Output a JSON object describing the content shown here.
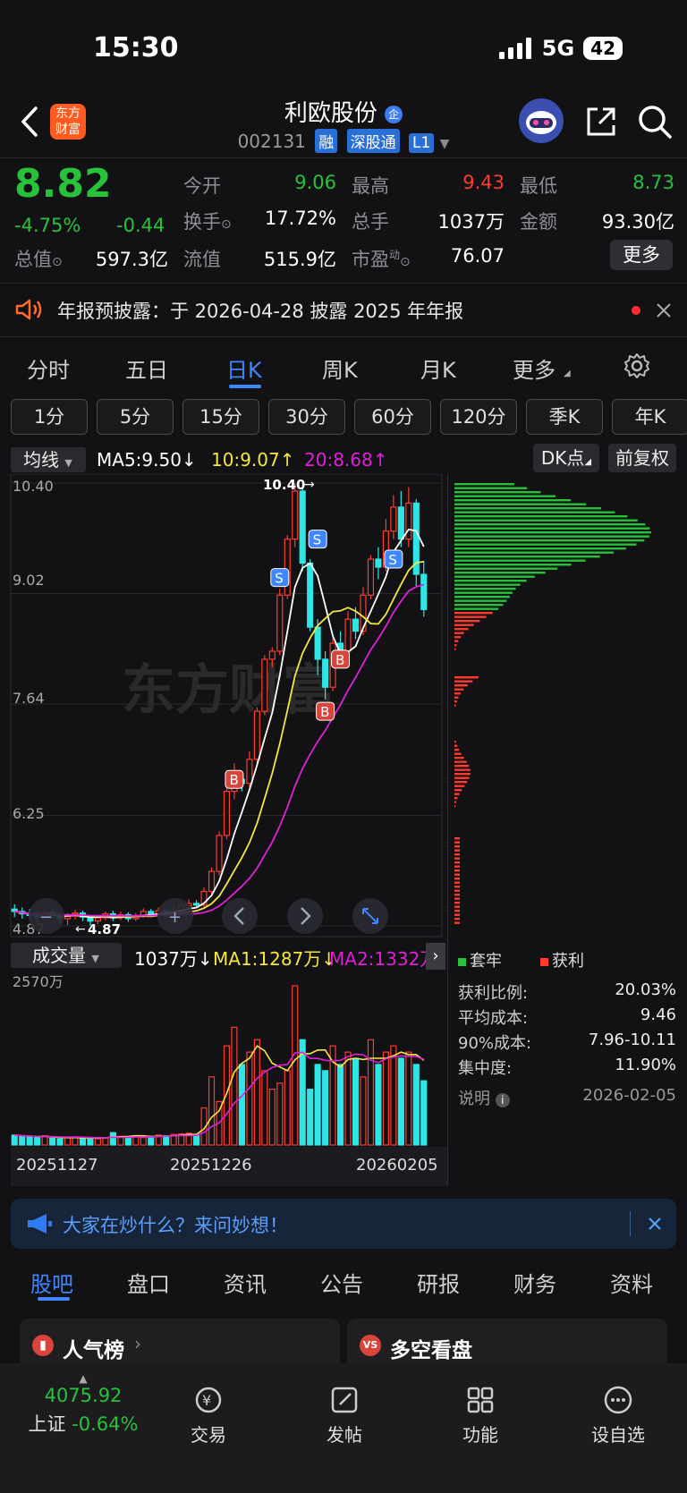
{
  "status": {
    "time": "15:30",
    "network": "5G",
    "battery": "42"
  },
  "header": {
    "title": "利欧股份",
    "title_badge": "企",
    "code": "002131",
    "tags": [
      "融",
      "深股通",
      "L1"
    ],
    "logo_text": "东方财富"
  },
  "quote": {
    "price": "8.82",
    "change_pct": "-4.75%",
    "change": "-0.44",
    "fields": [
      {
        "label": "今开",
        "value": "9.06"
      },
      {
        "label": "最高",
        "value": "9.43"
      },
      {
        "label": "最低",
        "value": "8.73"
      },
      {
        "label": "换手",
        "value": "17.72%"
      },
      {
        "label": "总手",
        "value": "1037万"
      },
      {
        "label": "金额",
        "value": "93.30亿"
      },
      {
        "label": "总值",
        "value": "597.3亿"
      },
      {
        "label": "流值",
        "value": "515.9亿"
      },
      {
        "label": "市盈",
        "value": "76.07",
        "sup": "动"
      }
    ],
    "more_label": "更多"
  },
  "notice": {
    "text": "年报预披露：于 2026-04-28 披露 2025 年年报"
  },
  "chart_tabs": [
    "分时",
    "五日",
    "日K",
    "周K",
    "月K",
    "更多"
  ],
  "periods": [
    "1分",
    "5分",
    "15分",
    "30分",
    "60分",
    "120分",
    "季K",
    "年K"
  ],
  "ma_bar": {
    "selector": "均线",
    "ma5": "MA5:9.50↓",
    "ma10": "10:9.07↑",
    "ma20": "20:8.68↑",
    "dk": "DK点",
    "adjust": "前复权"
  },
  "kline": {
    "price_labels": [
      "10.40",
      "9.02",
      "7.64",
      "6.25",
      "4.87"
    ],
    "high_marker": "10.40",
    "low_marker": "4.87",
    "signals": [
      "S",
      "S",
      "S",
      "B",
      "B",
      "B"
    ],
    "watermark": "东方财富"
  },
  "volume_bar": {
    "selector": "成交量",
    "vol": "1037万↓",
    "ma1": "MA1:1287万↓",
    "ma2": "MA2:1332万↓",
    "top_label": "2570万"
  },
  "dates": [
    "20251127",
    "20251226",
    "20260205"
  ],
  "chips": {
    "legend_trapped": "套牢",
    "legend_profit": "获利",
    "rows": [
      {
        "label": "获利比例:",
        "value": "20.03%"
      },
      {
        "label": "平均成本:",
        "value": "9.46"
      },
      {
        "label": "90%成本:",
        "value": "7.96-10.11"
      },
      {
        "label": "集中度:",
        "value": "11.90%"
      }
    ],
    "note_label": "说明",
    "note_date": "2026-02-05"
  },
  "banner": {
    "text": "大家在炒什么？来问妙想！"
  },
  "content_tabs": [
    "股吧",
    "盘口",
    "资讯",
    "公告",
    "研报",
    "财务",
    "资料"
  ],
  "cards": [
    "人气榜",
    "多空看盘"
  ],
  "bottom": {
    "index_value": "4075.92",
    "index_name": "上证",
    "index_change": "-0.64%",
    "items": [
      "交易",
      "发帖",
      "功能",
      "设自选"
    ]
  },
  "colors": {
    "up": "#ff3b30",
    "down": "#27c23a",
    "accent": "#2f7bf6",
    "cyan": "#2ee6e6"
  },
  "chart_data": {
    "type": "candlestick",
    "x_ticks": [
      "20251127",
      "20251226",
      "20260205"
    ],
    "ylim": [
      4.87,
      10.4
    ],
    "y_ticks": [
      10.4,
      9.02,
      7.64,
      6.25,
      4.87
    ],
    "last_close": 8.82,
    "ma": {
      "MA5": 9.5,
      "MA10": 9.07,
      "MA20": 8.68
    },
    "candles": [
      [
        5.08,
        5.05,
        5.14,
        4.98
      ],
      [
        5.05,
        5.02,
        5.1,
        4.96
      ],
      [
        5.02,
        5.0,
        5.08,
        4.95
      ],
      [
        5.0,
        4.98,
        5.06,
        4.92
      ],
      [
        4.98,
        5.04,
        5.08,
        4.94
      ],
      [
        5.04,
        5.0,
        5.09,
        4.96
      ],
      [
        5.0,
        4.96,
        5.04,
        4.9
      ],
      [
        4.96,
        4.99,
        5.03,
        4.88
      ],
      [
        4.99,
        5.03,
        5.07,
        4.95
      ],
      [
        5.03,
        4.98,
        5.06,
        4.93
      ],
      [
        4.98,
        4.93,
        5.0,
        4.87
      ],
      [
        4.93,
        4.97,
        5.01,
        4.89
      ],
      [
        4.97,
        5.02,
        5.05,
        4.94
      ],
      [
        5.02,
        4.97,
        5.06,
        4.93
      ],
      [
        4.97,
        5.01,
        5.05,
        4.94
      ],
      [
        5.01,
        4.96,
        5.04,
        4.92
      ],
      [
        4.96,
        5.0,
        5.03,
        4.93
      ],
      [
        5.0,
        5.05,
        5.09,
        4.97
      ],
      [
        5.05,
        5.01,
        5.08,
        4.98
      ],
      [
        5.01,
        5.06,
        5.1,
        4.98
      ],
      [
        5.06,
        5.02,
        5.09,
        4.99
      ],
      [
        5.02,
        5.07,
        5.11,
        5.0
      ],
      [
        5.07,
        5.12,
        5.16,
        5.04
      ],
      [
        5.12,
        5.15,
        5.2,
        5.08
      ],
      [
        5.15,
        5.13,
        5.19,
        5.09
      ],
      [
        5.13,
        5.3,
        5.35,
        5.1
      ],
      [
        5.3,
        5.55,
        5.6,
        5.26
      ],
      [
        5.55,
        6.0,
        6.05,
        5.5
      ],
      [
        6.0,
        6.55,
        6.6,
        5.95
      ],
      [
        6.55,
        6.7,
        6.9,
        6.45
      ],
      [
        6.7,
        6.65,
        6.8,
        6.55
      ],
      [
        6.65,
        6.95,
        7.05,
        6.6
      ],
      [
        6.95,
        7.55,
        7.6,
        6.9
      ],
      [
        7.55,
        8.2,
        8.25,
        7.5
      ],
      [
        8.2,
        8.3,
        8.35,
        8.1
      ],
      [
        8.3,
        9.0,
        9.08,
        8.25
      ],
      [
        9.0,
        9.7,
        9.75,
        8.95
      ],
      [
        9.7,
        10.3,
        10.4,
        9.6
      ],
      [
        10.3,
        9.4,
        10.35,
        9.3
      ],
      [
        9.4,
        8.6,
        9.45,
        8.55
      ],
      [
        8.6,
        8.2,
        8.7,
        8.0
      ],
      [
        8.2,
        7.85,
        8.3,
        7.7
      ],
      [
        7.85,
        8.4,
        8.5,
        7.8
      ],
      [
        8.4,
        8.3,
        8.55,
        8.1
      ],
      [
        8.3,
        8.7,
        8.8,
        8.2
      ],
      [
        8.7,
        8.55,
        8.85,
        8.45
      ],
      [
        8.55,
        9.0,
        9.1,
        8.5
      ],
      [
        9.0,
        9.45,
        9.5,
        8.95
      ],
      [
        9.45,
        9.35,
        9.6,
        9.2
      ],
      [
        9.35,
        9.8,
        9.95,
        9.3
      ],
      [
        9.8,
        10.1,
        10.25,
        9.7
      ],
      [
        10.1,
        9.7,
        10.3,
        9.6
      ],
      [
        9.7,
        10.15,
        10.35,
        9.6
      ],
      [
        10.15,
        9.26,
        10.2,
        9.1
      ],
      [
        9.26,
        8.82,
        9.43,
        8.73
      ]
    ],
    "volume": {
      "top_label": "2570万",
      "max": 2570,
      "last": 1037,
      "MA1": 1287,
      "MA2": 1332
    }
  }
}
